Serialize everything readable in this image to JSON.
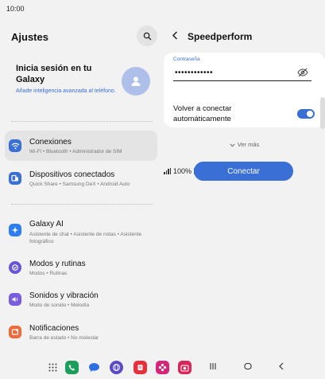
{
  "status_bar": {
    "time": "10:00",
    "battery": "100%"
  },
  "settings": {
    "title": "Ajustes",
    "account": {
      "title": "Inicia sesión en tu Galaxy",
      "subtitle": "Añade inteligencia avanzada al teléfono."
    },
    "items": [
      {
        "label": "Conexiones",
        "sub": "Wi-Fi • Bluetooth • Administrador de SIM",
        "icon": "wifi-icon",
        "color": "#3a6fd6"
      },
      {
        "label": "Dispositivos conectados",
        "sub": "Quick Share • Samsung DeX • Android Auto",
        "icon": "devices-icon",
        "color": "#3a6fd6"
      },
      {
        "label": "Galaxy AI",
        "sub": "Asistente de chat • Asistente de notas • Asistente fotográfico",
        "icon": "galaxy-ai-icon",
        "color": "#2f7ef0"
      },
      {
        "label": "Modos y rutinas",
        "sub": "Modos • Rutinas",
        "icon": "modes-icon",
        "color": "#6a55d6"
      },
      {
        "label": "Sonidos y vibración",
        "sub": "Modo de sonido • Melodía",
        "icon": "sound-icon",
        "color": "#7a5ce0"
      },
      {
        "label": "Notificaciones",
        "sub": "Barra de estado • No molestar",
        "icon": "notifications-icon",
        "color": "#ee6a3a"
      }
    ]
  },
  "wifi": {
    "title": "Speedperform",
    "password_label": "Contraseña",
    "password_value": "••••••••••••",
    "reconnect_label": "Volver a conectar automáticamente",
    "reconnect_on": true,
    "more": "Ver más",
    "connect": "Conectar"
  },
  "colors": {
    "accent": "#3a6fd6",
    "background": "#f2f2f2",
    "card": "#ffffff"
  }
}
